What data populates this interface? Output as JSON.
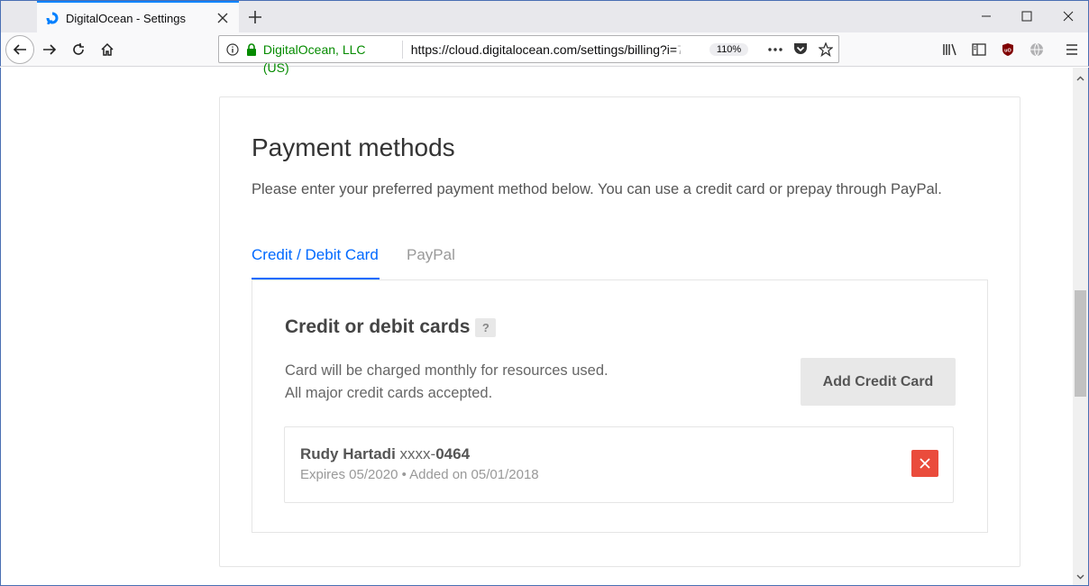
{
  "browser": {
    "tab_title": "DigitalOcean - Settings",
    "identity": "DigitalOcean, LLC (US)",
    "url_main": "https://cloud.digitalocean.com/settings/billing?i=",
    "url_fade": "7",
    "zoom": "110%",
    "accent_color": "#0a84ff",
    "secure_color": "#058b00"
  },
  "page": {
    "title": "Payment methods",
    "description": "Please enter your preferred payment method below. You can use a credit card or prepay through PayPal.",
    "tabs": [
      {
        "label": "Credit / Debit Card",
        "active": true
      },
      {
        "label": "PayPal",
        "active": false
      }
    ],
    "cards": {
      "title": "Credit or debit cards",
      "help": "?",
      "desc_line1": "Card will be charged monthly for resources used.",
      "desc_line2": "All major credit cards accepted.",
      "add_button": "Add Credit Card",
      "items": [
        {
          "holder": "Rudy Hartadi",
          "masked": "xxxx-",
          "last4": "0464",
          "meta": "Expires 05/2020 • Added on 05/01/2018"
        }
      ]
    },
    "accent_color": "#0069ff",
    "delete_color": "#ea4c3c"
  }
}
